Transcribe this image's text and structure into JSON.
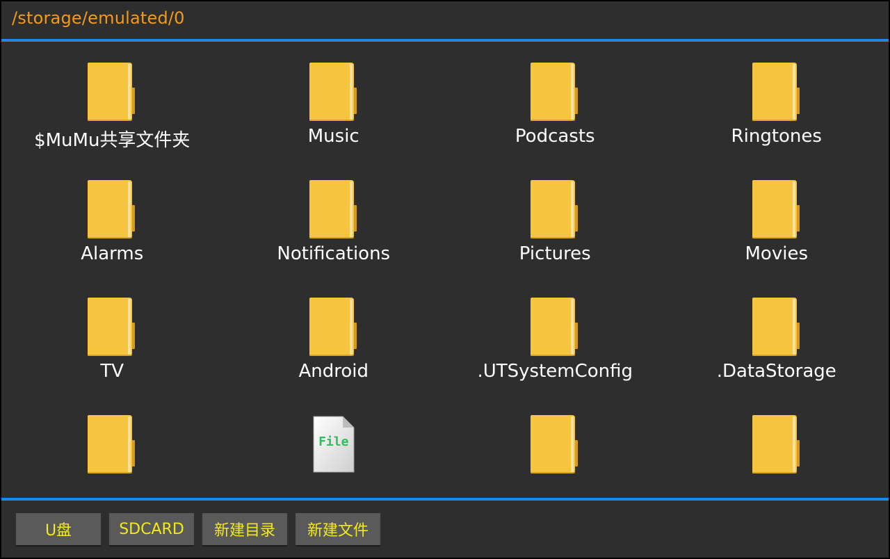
{
  "path": "/storage/emulated/0",
  "colors": {
    "accent": "#1e88e5",
    "path_text": "#f39a1a",
    "button_text": "#f2ea18",
    "folder": "#f6c43f"
  },
  "items": [
    {
      "label": "$MuMu共享文件夹",
      "type": "folder",
      "icon": "folder-icon"
    },
    {
      "label": "Music",
      "type": "folder",
      "icon": "folder-icon"
    },
    {
      "label": "Podcasts",
      "type": "folder",
      "icon": "folder-icon"
    },
    {
      "label": "Ringtones",
      "type": "folder",
      "icon": "folder-icon"
    },
    {
      "label": "Alarms",
      "type": "folder",
      "icon": "folder-icon"
    },
    {
      "label": "Notifications",
      "type": "folder",
      "icon": "folder-icon"
    },
    {
      "label": "Pictures",
      "type": "folder",
      "icon": "folder-icon"
    },
    {
      "label": "Movies",
      "type": "folder",
      "icon": "folder-icon"
    },
    {
      "label": "TV",
      "type": "folder",
      "icon": "folder-icon"
    },
    {
      "label": "Android",
      "type": "folder",
      "icon": "folder-icon"
    },
    {
      "label": ".UTSystemConfig",
      "type": "folder",
      "icon": "folder-icon"
    },
    {
      "label": ".DataStorage",
      "type": "folder",
      "icon": "folder-icon"
    },
    {
      "label": "",
      "type": "folder",
      "icon": "folder-icon"
    },
    {
      "label": "",
      "type": "file",
      "icon": "file-icon",
      "icon_text": "File"
    },
    {
      "label": "",
      "type": "folder",
      "icon": "folder-icon"
    },
    {
      "label": "",
      "type": "folder",
      "icon": "folder-icon"
    }
  ],
  "buttons": {
    "udisk": "U盘",
    "sdcard": "SDCARD",
    "new_dir": "新建目录",
    "new_file": "新建文件"
  }
}
